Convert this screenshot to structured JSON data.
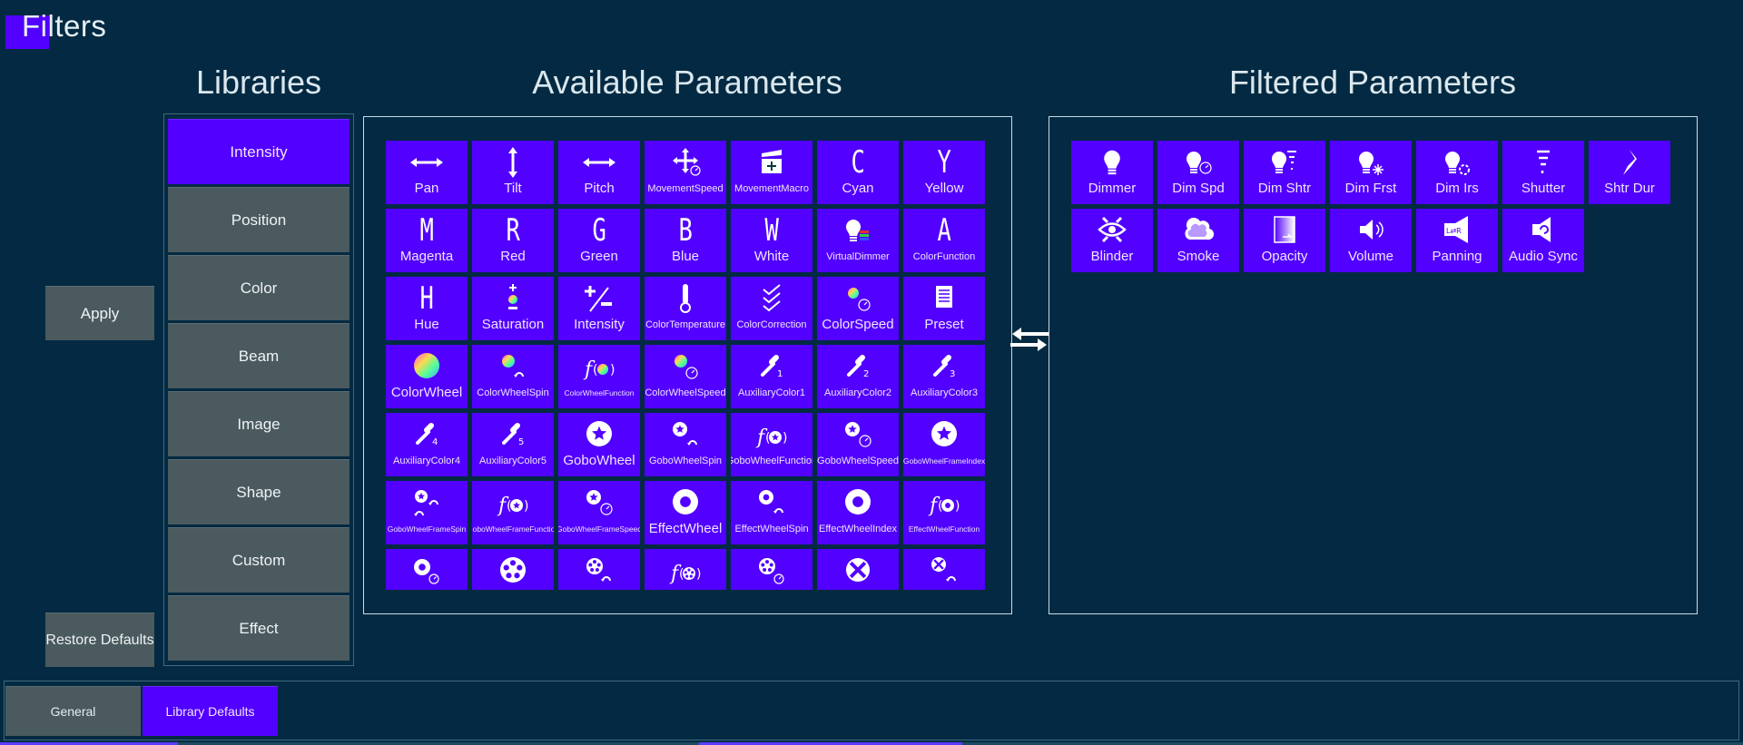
{
  "page": {
    "title": "Filters"
  },
  "colors": {
    "accent": "#5200ff",
    "background": "#032a42",
    "button_gray": "#4a5a5e",
    "panel_border": "#c9dbe4"
  },
  "libraries": {
    "title": "Libraries",
    "selected": "Intensity",
    "items": [
      {
        "label": "Intensity"
      },
      {
        "label": "Position"
      },
      {
        "label": "Color"
      },
      {
        "label": "Beam"
      },
      {
        "label": "Image"
      },
      {
        "label": "Shape"
      },
      {
        "label": "Custom"
      },
      {
        "label": "Effect"
      }
    ]
  },
  "actions": {
    "apply_label": "Apply",
    "restore_label": "Restore Defaults"
  },
  "available": {
    "title": "Available Parameters",
    "items": [
      {
        "label": "Pan",
        "icon": "horizontal-arrows-icon"
      },
      {
        "label": "Tilt",
        "icon": "vertical-arrows-icon"
      },
      {
        "label": "Pitch",
        "icon": "horizontal-arrows-icon"
      },
      {
        "label": "MovementSpeed",
        "icon": "move-speed-icon"
      },
      {
        "label": "MovementMacro",
        "icon": "clapperboard-icon"
      },
      {
        "label": "Cyan",
        "icon": "letter-c-icon",
        "glyph": "C"
      },
      {
        "label": "Yellow",
        "icon": "letter-y-icon",
        "glyph": "Y"
      },
      {
        "label": "Magenta",
        "icon": "letter-m-icon",
        "glyph": "M"
      },
      {
        "label": "Red",
        "icon": "letter-r-icon",
        "glyph": "R"
      },
      {
        "label": "Green",
        "icon": "letter-g-icon",
        "glyph": "G"
      },
      {
        "label": "Blue",
        "icon": "letter-b-icon",
        "glyph": "B"
      },
      {
        "label": "White",
        "icon": "letter-w-icon",
        "glyph": "W"
      },
      {
        "label": "VirtualDimmer",
        "icon": "bulb-rgb-icon"
      },
      {
        "label": "ColorFunction",
        "icon": "letter-a-icon",
        "glyph": "A"
      },
      {
        "label": "Hue",
        "icon": "letter-h-icon",
        "glyph": "H"
      },
      {
        "label": "Saturation",
        "icon": "saturation-icon"
      },
      {
        "label": "Intensity",
        "icon": "plus-minus-icon"
      },
      {
        "label": "ColorTemperature",
        "icon": "thermometer-icon"
      },
      {
        "label": "ColorCorrection",
        "icon": "checks-icon"
      },
      {
        "label": "ColorSpeed",
        "icon": "color-speed-icon"
      },
      {
        "label": "Preset",
        "icon": "document-icon"
      },
      {
        "label": "ColorWheel",
        "icon": "color-wheel-icon"
      },
      {
        "label": "ColorWheelSpin",
        "icon": "color-wheel-spin-icon"
      },
      {
        "label": "ColorWheelFunction",
        "icon": "color-wheel-function-icon"
      },
      {
        "label": "ColorWheelSpeed",
        "icon": "color-wheel-speed-icon"
      },
      {
        "label": "AuxiliaryColor1",
        "icon": "eyedropper-icon",
        "sub": "1"
      },
      {
        "label": "AuxiliaryColor2",
        "icon": "eyedropper-icon",
        "sub": "2"
      },
      {
        "label": "AuxiliaryColor3",
        "icon": "eyedropper-icon",
        "sub": "3"
      },
      {
        "label": "AuxiliaryColor4",
        "icon": "eyedropper-icon",
        "sub": "4"
      },
      {
        "label": "AuxiliaryColor5",
        "icon": "eyedropper-icon",
        "sub": "5"
      },
      {
        "label": "GoboWheel",
        "icon": "gobo-wheel-icon"
      },
      {
        "label": "GoboWheelSpin",
        "icon": "gobo-wheel-spin-icon"
      },
      {
        "label": "GoboWheelFunction",
        "icon": "gobo-wheel-function-icon"
      },
      {
        "label": "GoboWheelSpeed",
        "icon": "gobo-wheel-speed-icon"
      },
      {
        "label": "GoboWheelFrameIndex",
        "icon": "gobo-wheel-icon"
      },
      {
        "label": "GoboWheelFrameSpin",
        "icon": "gobo-frame-spin-icon"
      },
      {
        "label": "GoboWheelFrameFunction",
        "icon": "gobo-wheel-function-icon"
      },
      {
        "label": "GoboWheelFrameSpeed",
        "icon": "gobo-wheel-speed-icon"
      },
      {
        "label": "EffectWheel",
        "icon": "effect-wheel-icon"
      },
      {
        "label": "EffectWheelSpin",
        "icon": "effect-wheel-spin-icon"
      },
      {
        "label": "EffectWheelIndex",
        "icon": "effect-wheel-icon"
      },
      {
        "label": "EffectWheelFunction",
        "icon": "effect-wheel-function-icon"
      },
      {
        "label": "",
        "icon": "effect-wheel-speed-icon"
      },
      {
        "label": "",
        "icon": "film-reel-icon"
      },
      {
        "label": "",
        "icon": "film-reel-spin-icon"
      },
      {
        "label": "",
        "icon": "film-reel-function-icon"
      },
      {
        "label": "",
        "icon": "film-reel-speed-icon"
      },
      {
        "label": "",
        "icon": "cross-circle-icon"
      },
      {
        "label": "",
        "icon": "cross-circle-spin-icon"
      }
    ]
  },
  "filtered": {
    "title": "Filtered Parameters",
    "items": [
      {
        "label": "Dimmer",
        "icon": "bulb-icon"
      },
      {
        "label": "Dim Spd",
        "icon": "bulb-speed-icon"
      },
      {
        "label": "Dim Shtr",
        "icon": "bulb-shutter-icon"
      },
      {
        "label": "Dim Frst",
        "icon": "bulb-frost-icon"
      },
      {
        "label": "Dim Irs",
        "icon": "bulb-iris-icon"
      },
      {
        "label": "Shutter",
        "icon": "shutter-icon"
      },
      {
        "label": "Shtr Dur",
        "icon": "shutter-duration-icon"
      },
      {
        "label": "Blinder",
        "icon": "blinder-eye-icon"
      },
      {
        "label": "Smoke",
        "icon": "cloud-icon"
      },
      {
        "label": "Opacity",
        "icon": "opacity-icon"
      },
      {
        "label": "Volume",
        "icon": "speaker-icon"
      },
      {
        "label": "Panning",
        "icon": "speaker-panning-icon"
      },
      {
        "label": "Audio Sync",
        "icon": "speaker-sync-icon"
      }
    ]
  },
  "transfer": {
    "icon": "swap-arrows-icon"
  },
  "tabs": [
    {
      "label": "General",
      "active": false
    },
    {
      "label": "Library Defaults",
      "active": true
    }
  ]
}
